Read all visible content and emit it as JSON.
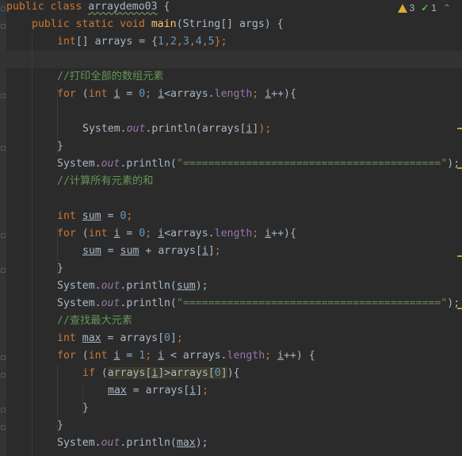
{
  "editor": {
    "inspections": {
      "warnings": "3",
      "weak_warnings": "1"
    },
    "code": {
      "class_kw": "public class ",
      "class_name": "arraydemo03",
      "class_open": " {",
      "main_mod": "public static void ",
      "main_name": "main",
      "main_params": "(String[] args) {",
      "l3_type": "int",
      "l3_decl": "[] arrays = {",
      "l3_n1": "1",
      "l3_n2": "2",
      "l3_n3": "3",
      "l3_n4": "4",
      "l3_n5": "5",
      "comma": ",",
      "l3_end": "};",
      "c1": "//打印全部的数组元素",
      "for_kw": "for",
      "int_kw": "int",
      "i_var": "i",
      "zero": "0",
      "one": "1",
      "arrays_length": "arrays.",
      "length": "length",
      "sys": "System.",
      "out": "out",
      "println": ".println(",
      "arrays_idx": "arrays[",
      "close_paren_semi": ");",
      "separator": "\"=========================================\"",
      "c2": "//计算所有元素的和",
      "sum_var": "sum",
      "c3": "//查找最大元素",
      "max_var": "max",
      "brace_close": "}"
    }
  }
}
